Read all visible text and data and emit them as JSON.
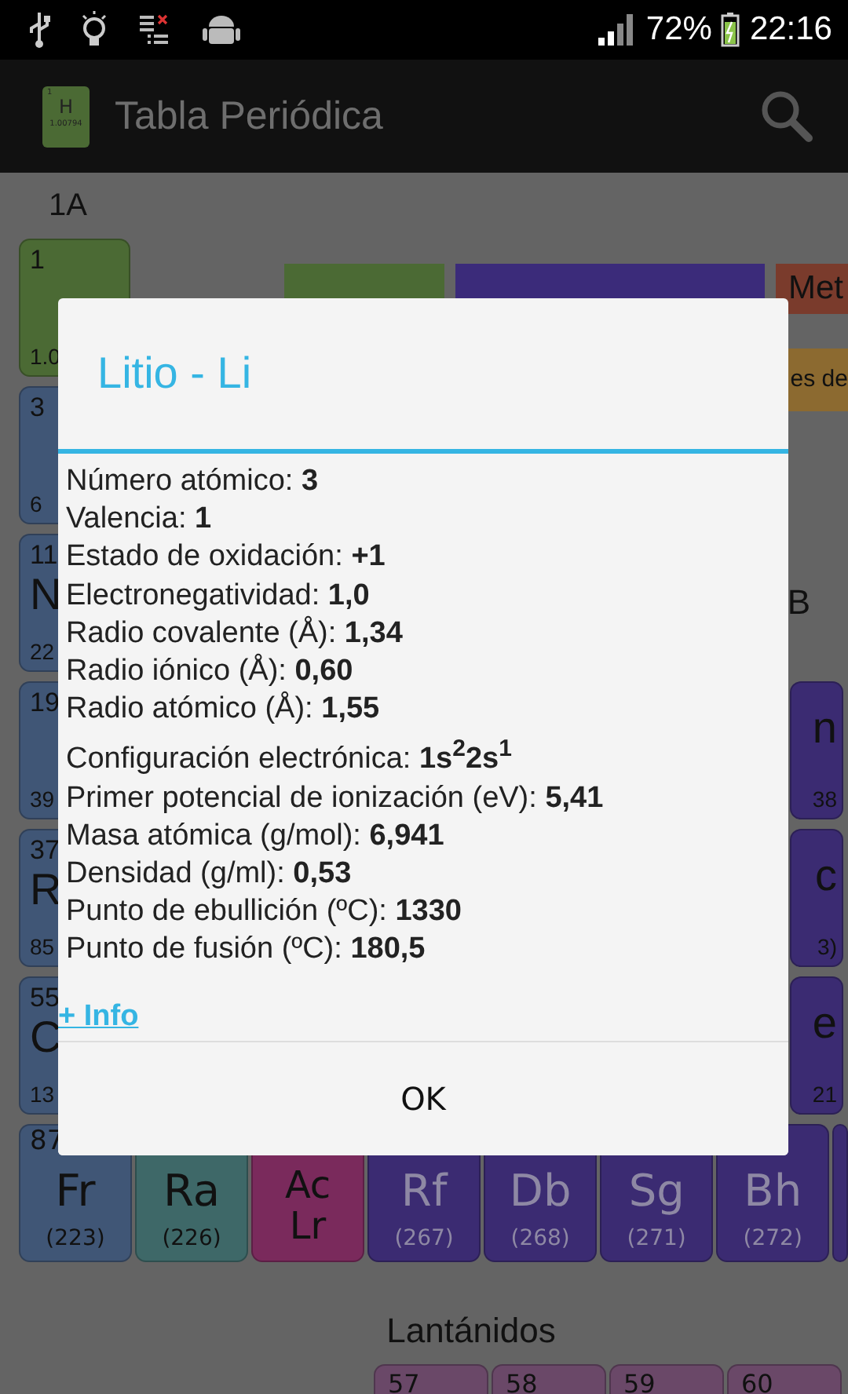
{
  "status_bar": {
    "battery": "72%",
    "time": "22:16"
  },
  "app_bar": {
    "logo": {
      "number": "1",
      "symbol": "H",
      "weight": "1.00794"
    },
    "title": "Tabla Periódica"
  },
  "periodic_table": {
    "group_label": "1A",
    "legend": [
      {
        "color": "#4b6a34"
      },
      {
        "color": "#3b2b7a"
      },
      {
        "text": "Met",
        "color": "#7a3b2c"
      },
      {
        "text": "es de",
        "color": "#8c6a30"
      }
    ],
    "rows": [
      {
        "left": {
          "number": "1",
          "weight": "1.0",
          "color": "#4b6a34"
        }
      },
      {
        "left": {
          "number": "3",
          "weight": "6",
          "color": "#405676"
        }
      },
      {
        "left": {
          "number": "11",
          "symbol": "N",
          "weight": "22",
          "color": "#405676"
        },
        "group_label": "B"
      },
      {
        "left": {
          "number": "19",
          "weight": "39",
          "color": "#405676"
        },
        "right": {
          "symbol": "n",
          "weight": "38",
          "color": "#3b2b72"
        }
      },
      {
        "left": {
          "number": "37",
          "symbol": "R",
          "weight": "85",
          "color": "#405676"
        },
        "right": {
          "symbol": "c",
          "weight": "3)",
          "color": "#3b2b72"
        }
      },
      {
        "left": {
          "number": "55",
          "symbol": "C",
          "weight": "13",
          "color": "#405676"
        },
        "right": {
          "symbol": "e",
          "weight": "21",
          "color": "#3b2b72"
        }
      }
    ],
    "bottom_row": [
      {
        "number": "87",
        "symbol": "Fr",
        "weight": "(223)",
        "color": "#405676",
        "synthetic": false
      },
      {
        "symbol": "Ra",
        "weight": "(226)",
        "color": "#3e6868",
        "synthetic": false
      },
      {
        "symbol": "Ac",
        "symbol_2": "Lr",
        "color": "#7a2a5c",
        "synthetic": false
      },
      {
        "symbol": "Rf",
        "weight": "(267)",
        "color": "#3b2b72",
        "synthetic": true
      },
      {
        "symbol": "Db",
        "weight": "(268)",
        "color": "#3b2b72",
        "synthetic": true
      },
      {
        "symbol": "Sg",
        "weight": "(271)",
        "color": "#3b2b72",
        "synthetic": true
      },
      {
        "symbol": "Bh",
        "weight": "(272)",
        "color": "#3b2b72",
        "synthetic": true
      }
    ],
    "lanthanides": {
      "title": "Lantánidos",
      "tiles": [
        {
          "number": "57"
        },
        {
          "number": "58"
        },
        {
          "number": "59"
        },
        {
          "number": "60"
        }
      ]
    }
  },
  "dialog": {
    "title": "Litio - Li",
    "properties": [
      {
        "label": "Número atómico: ",
        "value": "3"
      },
      {
        "label": "Valencia: ",
        "value": "1"
      },
      {
        "label": "Estado de oxidación: ",
        "value": "+1"
      },
      {
        "label": "Electronegatividad: ",
        "value": "1,0"
      },
      {
        "label": "Radio covalente (Å): ",
        "value": "1,34"
      },
      {
        "label": "Radio iónico (Å): ",
        "value": "0,60"
      },
      {
        "label": "Radio atómico (Å): ",
        "value": "1,55"
      },
      {
        "label": "Configuración electrónica: ",
        "value": "1s$^{2}$2s$^{1}$"
      },
      {
        "label": "Primer potencial de ionización (eV): ",
        "value": "5,41"
      },
      {
        "label": "Masa atómica (g/mol): ",
        "value": "6,941"
      },
      {
        "label": "Densidad (g/ml): ",
        "value": "0,53"
      },
      {
        "label": "Punto de ebullición (ºC): ",
        "value": "1330"
      },
      {
        "label": "Punto de fusión (ºC): ",
        "value": "180,5"
      }
    ],
    "link": "+ Info",
    "button": "OK"
  }
}
